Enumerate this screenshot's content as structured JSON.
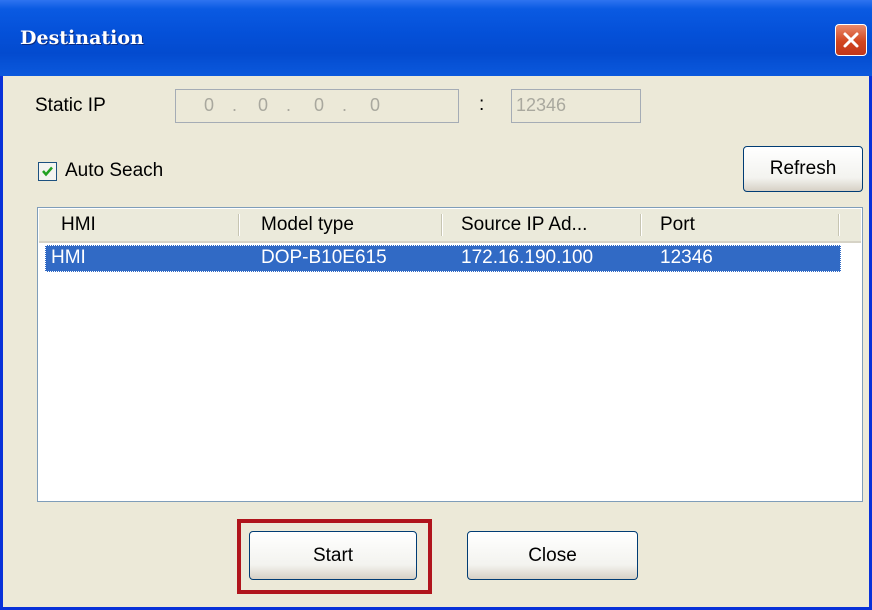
{
  "window": {
    "title": "Destination",
    "close_icon": "close-x-icon"
  },
  "static_ip": {
    "label": "Static IP",
    "octets": [
      "0",
      "0",
      "0",
      "0"
    ],
    "separator": ":",
    "port": "12346"
  },
  "auto_search": {
    "label": "Auto Seach",
    "checked": true
  },
  "refresh_button": {
    "label": "Refresh"
  },
  "list": {
    "columns": [
      "HMI",
      "Model type",
      "Source IP Ad...",
      "Port"
    ],
    "rows": [
      {
        "hmi": "HMI",
        "model": "DOP-B10E615",
        "ip": "172.16.190.100",
        "port": "12346",
        "selected": true
      }
    ]
  },
  "buttons": {
    "start": "Start",
    "close": "Close"
  },
  "colors": {
    "titlebar": "#0450d8",
    "selection": "#316ac5",
    "highlight_box": "#b0141c"
  }
}
